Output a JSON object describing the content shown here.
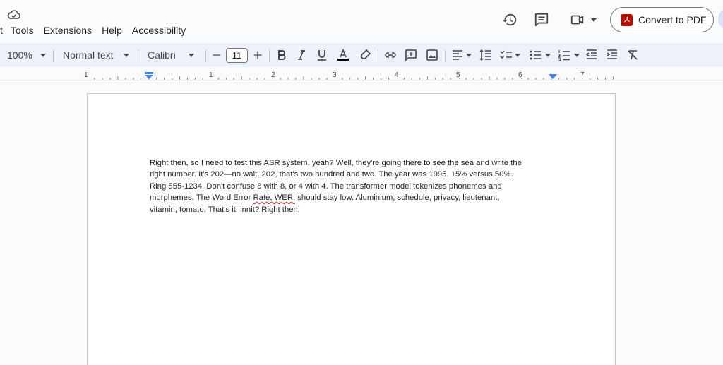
{
  "menu": {
    "items": [
      "t",
      "Tools",
      "Extensions",
      "Help",
      "Accessibility"
    ]
  },
  "header": {
    "convert_label": "Convert to PDF"
  },
  "toolbar": {
    "zoom": "100%",
    "style": "Normal text",
    "font": "Calibri",
    "font_size": "11"
  },
  "ruler": {
    "numbers": [
      "1",
      "1",
      "2",
      "3",
      "4",
      "5",
      "6",
      "7"
    ]
  },
  "document": {
    "line1": "Right then, so I need to test this ASR system, yeah? Well, they're going there to see the sea and write the",
    "line2": "right number. It's 202—no wait, 202, that's two hundred and two. The year was 1995. 15% versus 50%.",
    "line3": "Ring 555-1234. Don't confuse 8 with 8, or 4 with 4. The transformer model tokenizes phonemes and",
    "line4_before": "morphemes. The Word Error ",
    "line4_flagged": "Rate, WER,",
    "line4_after": " should stay low. Aluminium, schedule, privacy, lieutenant,",
    "line5": "vitamin, tomato. That's it, innit? Right then."
  },
  "colors": {
    "pdf_red": "#b30b00",
    "toolbar_bg": "#edf2fa",
    "ruler_marker": "#4285f4",
    "spellcheck": "#d93025"
  },
  "icons": [
    "cloud-icon",
    "history-icon",
    "comment-icon",
    "video-call-icon",
    "pdf-icon",
    "bold-icon",
    "italic-icon",
    "underline-icon",
    "text-color-icon",
    "highlight-icon",
    "link-icon",
    "add-comment-icon",
    "image-icon",
    "align-left-icon",
    "line-spacing-icon",
    "checklist-icon",
    "bulleted-list-icon",
    "numbered-list-icon",
    "decrease-indent-icon",
    "increase-indent-icon",
    "clear-formatting-icon"
  ]
}
